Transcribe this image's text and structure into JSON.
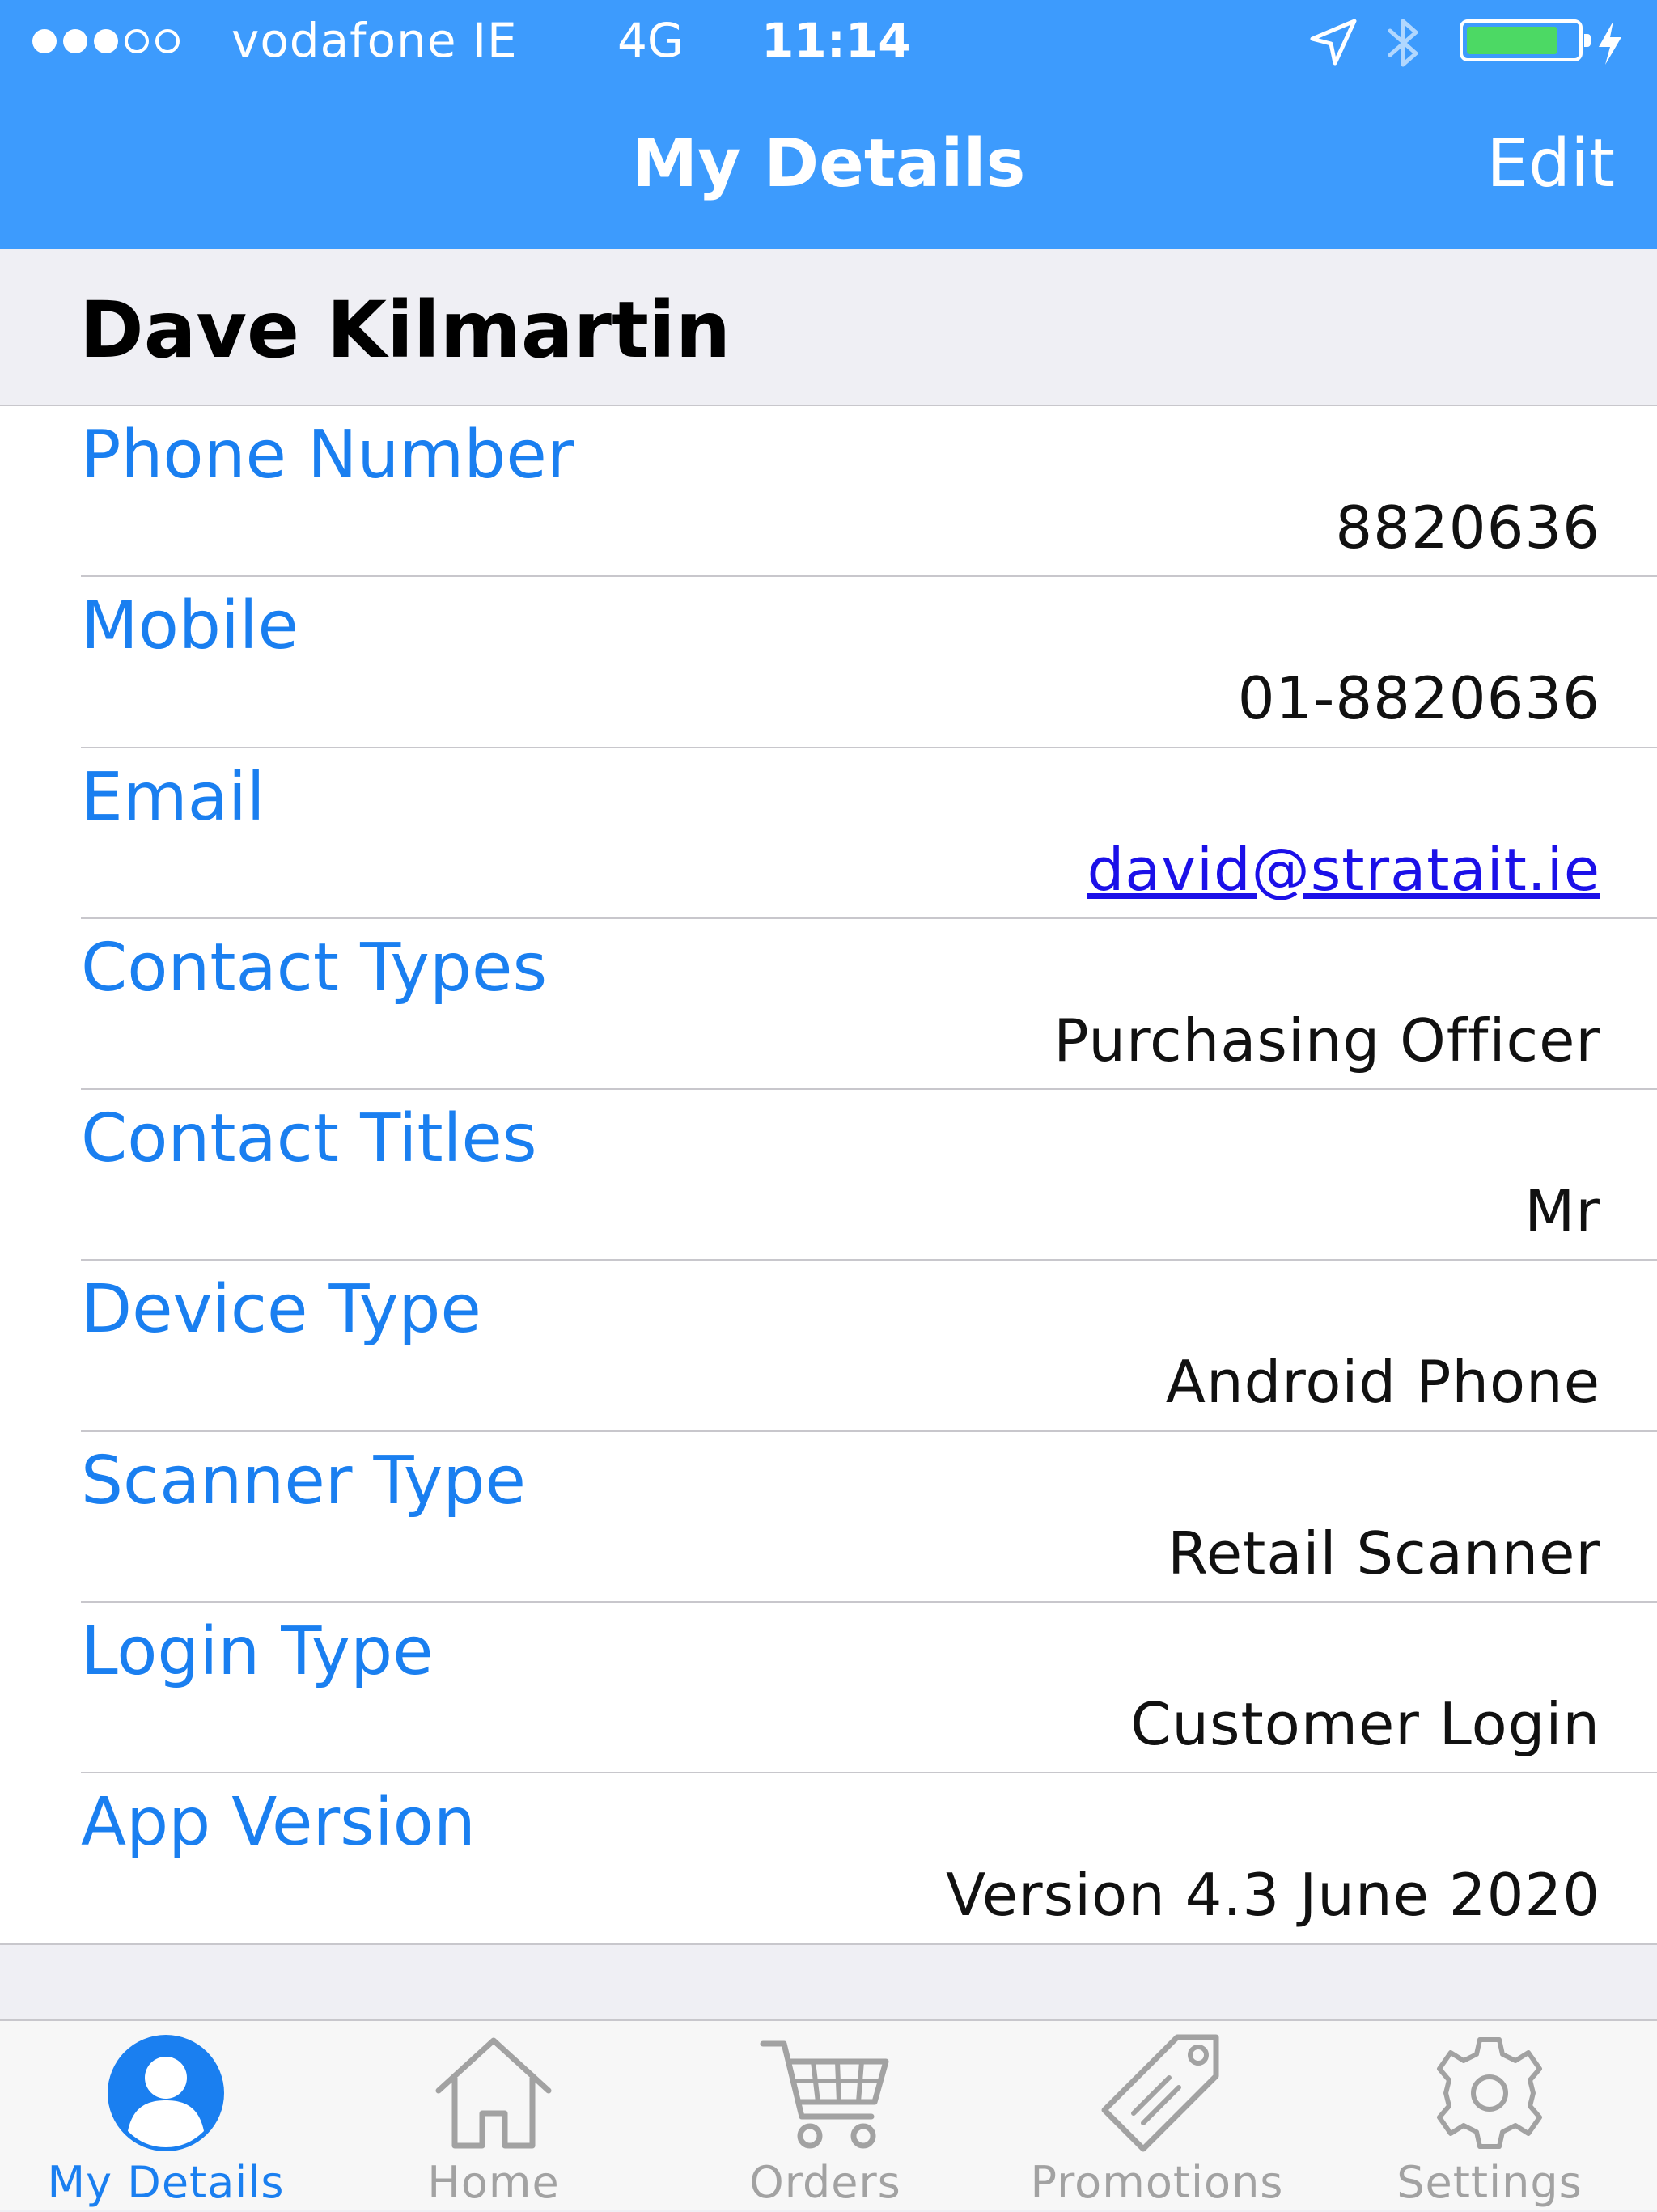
{
  "status_bar": {
    "carrier": "vodafone IE",
    "network": "4G",
    "time": "11:14",
    "signal_bars_filled": 3,
    "signal_bars_total": 5,
    "battery_level": 0.85
  },
  "nav": {
    "title": "My Details",
    "edit_label": "Edit"
  },
  "contact": {
    "name": "Dave Kilmartin"
  },
  "details": [
    {
      "label": "Phone Number",
      "value": "8820636"
    },
    {
      "label": "Mobile",
      "value": "01-8820636"
    },
    {
      "label": "Email",
      "value": "david@stratait.ie"
    },
    {
      "label": "Contact Types",
      "value": "Purchasing Officer"
    },
    {
      "label": "Contact Titles",
      "value": "Mr"
    },
    {
      "label": "Device Type",
      "value": "Android Phone"
    },
    {
      "label": "Scanner Type",
      "value": "Retail Scanner"
    },
    {
      "label": "Login Type",
      "value": "Customer Login"
    },
    {
      "label": "App Version",
      "value": "Version 4.3 June 2020"
    }
  ],
  "tabs": [
    {
      "label": "My Details",
      "icon": "person-icon",
      "active": true
    },
    {
      "label": "Home",
      "icon": "home-icon",
      "active": false
    },
    {
      "label": "Orders",
      "icon": "cart-icon",
      "active": false
    },
    {
      "label": "Promotions",
      "icon": "tag-icon",
      "active": false
    },
    {
      "label": "Settings",
      "icon": "gear-icon",
      "active": false
    }
  ],
  "colors": {
    "accent": "#1a7ff0",
    "header": "#3d9bfd",
    "link": "#1b10e8",
    "inactive_tab": "#a2a2a2",
    "battery": "#4cd964"
  }
}
